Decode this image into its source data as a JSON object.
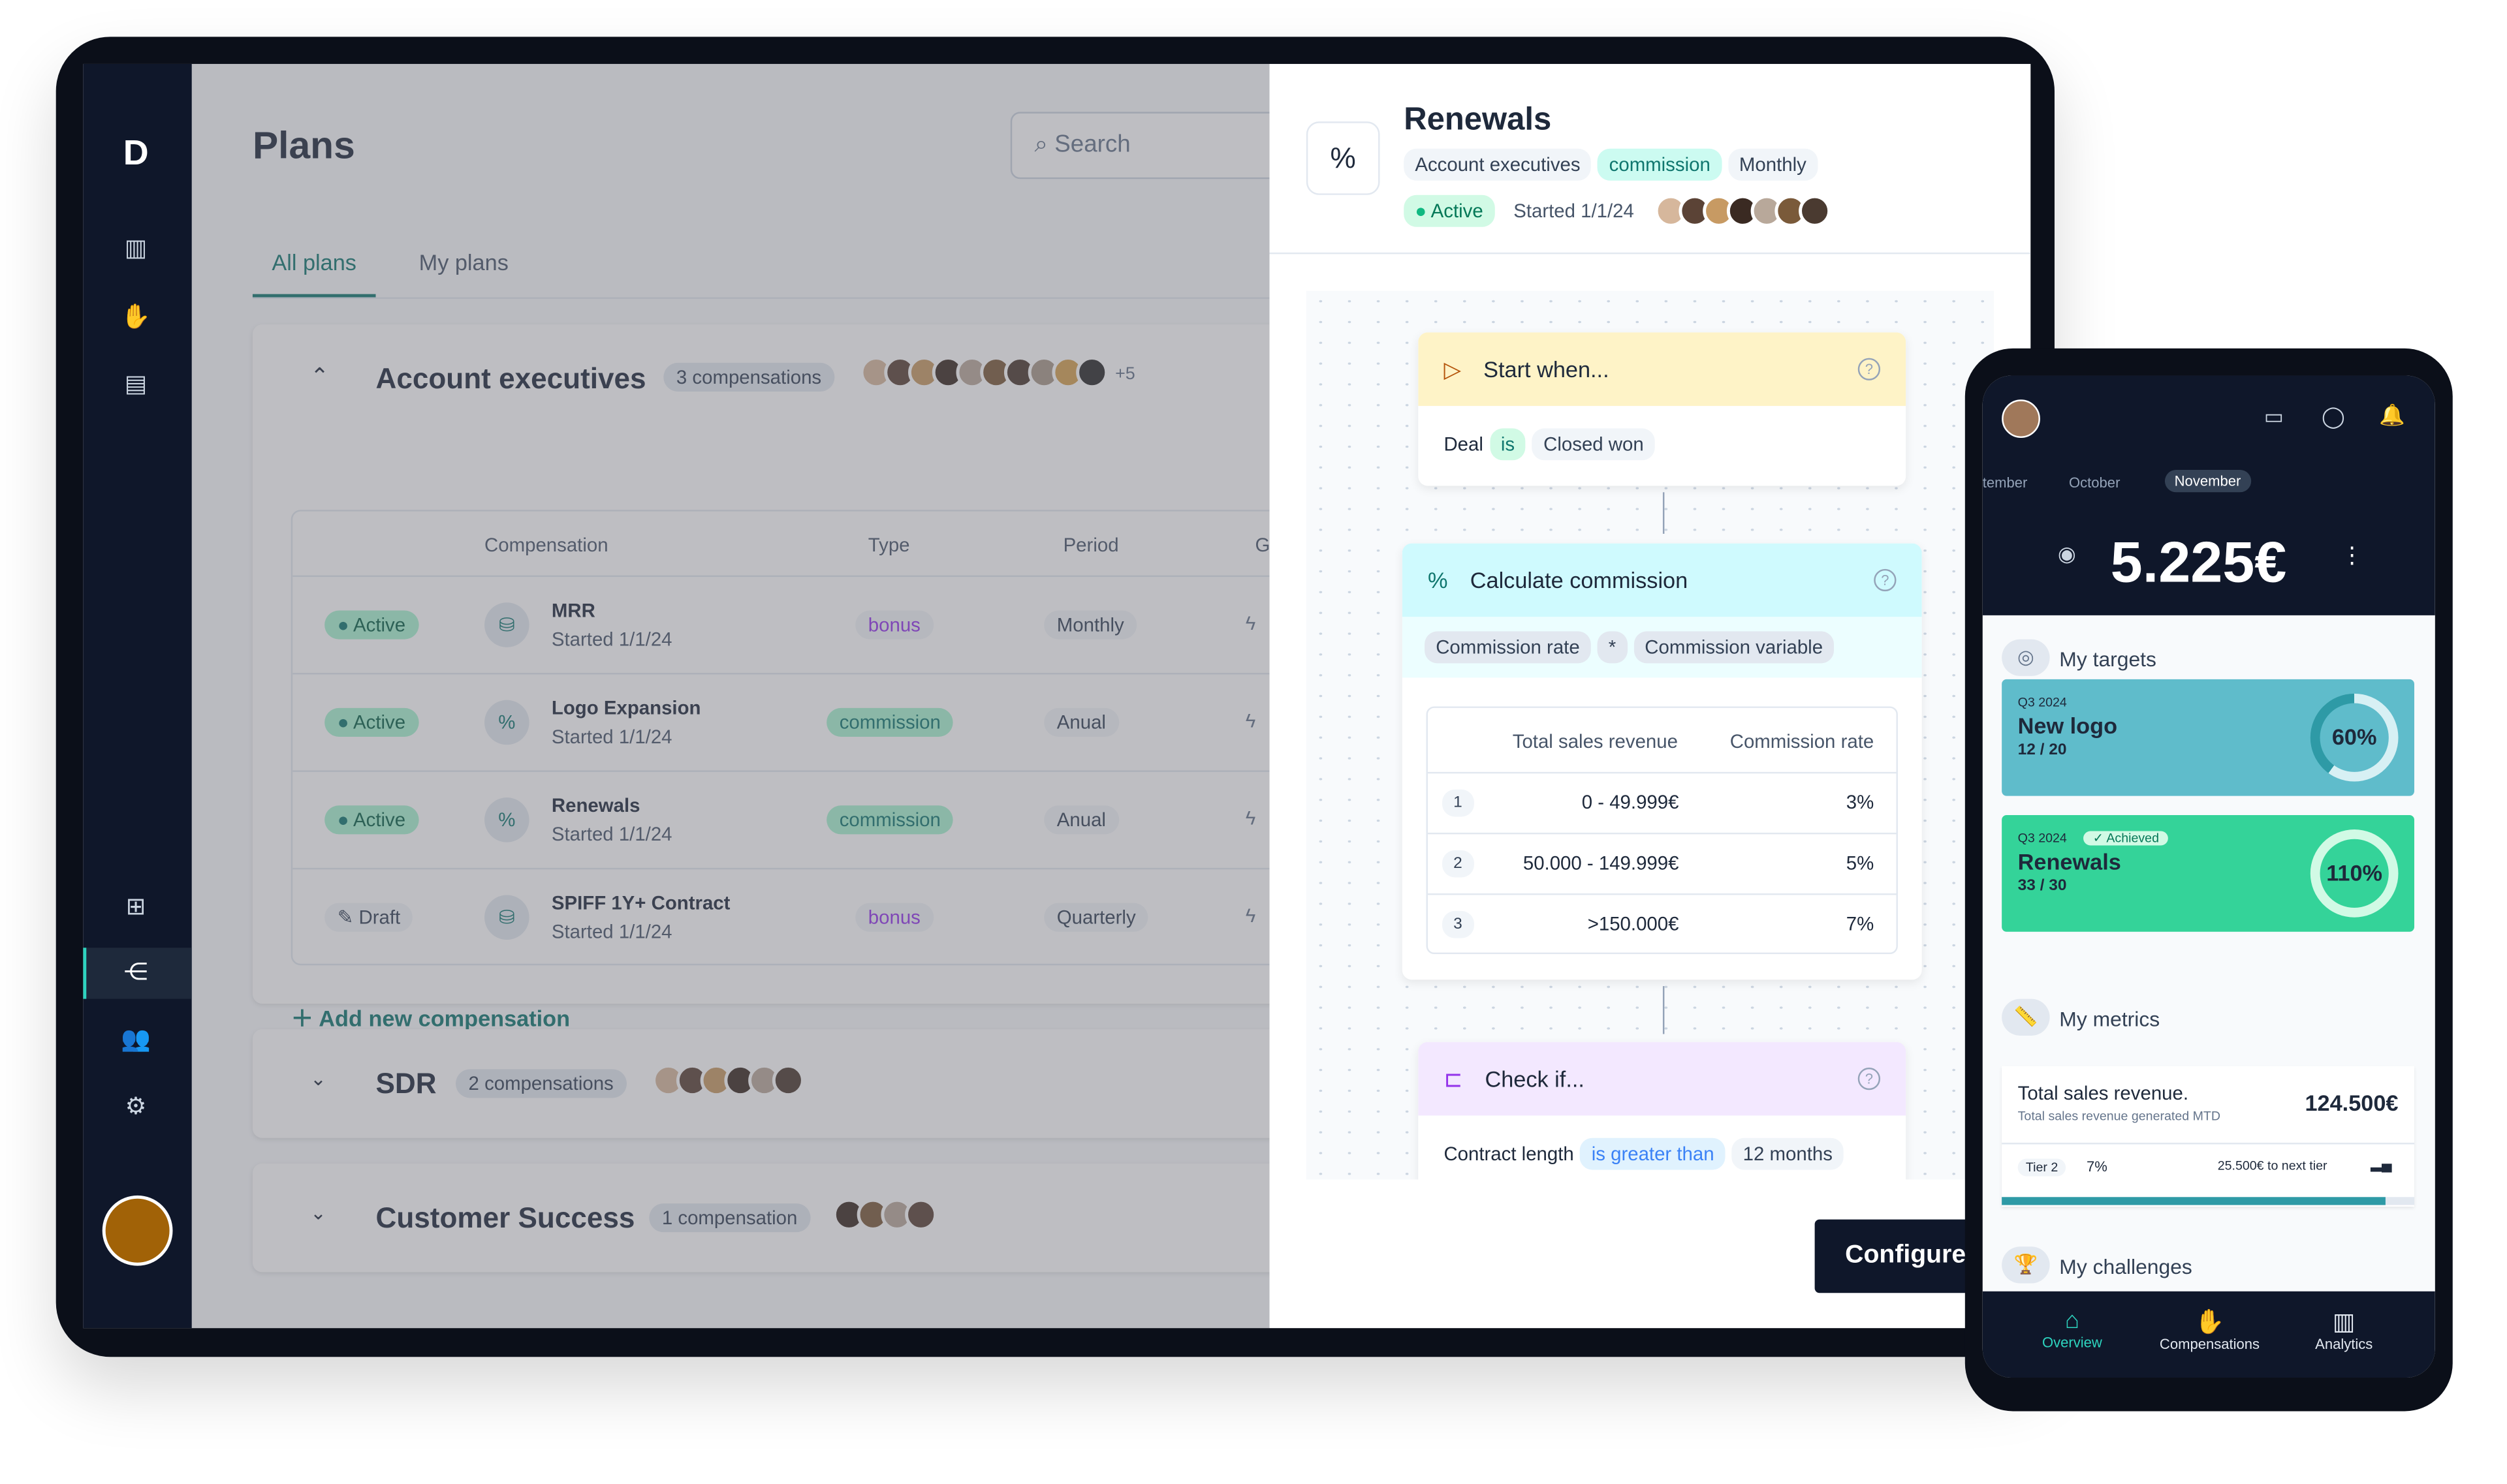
{
  "colors": {
    "accent": "#0f766e",
    "active": "#10b981",
    "commission": "#a7f3d0",
    "bonus": "#9333ea",
    "sidebar": "#0f172a"
  },
  "sidebar": {
    "icons": [
      "logo-icon",
      "dashboard-icon",
      "compensation-icon",
      "document-icon",
      "org-chart-icon",
      "workflow-icon",
      "users-icon",
      "settings-icon"
    ]
  },
  "plans": {
    "title": "Plans",
    "search_placeholder": "Search",
    "tabs": [
      {
        "label": "All plans"
      },
      {
        "label": "My plans"
      }
    ],
    "groups": [
      {
        "name": "Account executives",
        "count": "3 compensations",
        "extra": "+5",
        "columns": [
          "Compensation",
          "Type",
          "Period",
          "G"
        ],
        "rows": [
          {
            "status": "Active",
            "name": "MRR",
            "started": "Started 1/1/24",
            "type": "bonus",
            "period": "Monthly",
            "icon": "gift-icon"
          },
          {
            "status": "Active",
            "name": "Logo Expansion",
            "started": "Started 1/1/24",
            "type": "commission",
            "period": "Anual",
            "icon": "percent-icon"
          },
          {
            "status": "Active",
            "name": "Renewals",
            "started": "Started 1/1/24",
            "type": "commission",
            "period": "Anual",
            "icon": "percent-icon"
          },
          {
            "status": "Draft",
            "name": "SPIFF 1Y+ Contract",
            "started": "Started 1/1/24",
            "type": "bonus",
            "period": "Quarterly",
            "icon": "gift-icon"
          }
        ],
        "add_label": "Add new compensation"
      },
      {
        "name": "SDR",
        "count": "2 compensations"
      },
      {
        "name": "Customer Success",
        "count": "1 compensation"
      }
    ]
  },
  "detail": {
    "title": "Renewals",
    "tags": [
      "Account executives",
      "commission",
      "Monthly"
    ],
    "status": "Active",
    "started": "Started 1/1/24",
    "start": {
      "title": "Start when...",
      "conds": [
        "Deal",
        "is",
        "Closed won"
      ]
    },
    "calc": {
      "title": "Calculate commission",
      "formula": [
        "Commission rate",
        "*",
        "Commission variable"
      ],
      "headers": [
        "Total sales revenue",
        "Commission rate"
      ],
      "tiers": [
        {
          "n": "1",
          "range": "0 - 49.999€",
          "rate": "3%"
        },
        {
          "n": "2",
          "range": "50.000 - 149.999€",
          "rate": "5%"
        },
        {
          "n": "3",
          "range": ">150.000€",
          "rate": "7%"
        }
      ]
    },
    "check": {
      "title": "Check if...",
      "conds": [
        "Contract length",
        "is greater than",
        "12 months"
      ]
    },
    "configure": "Configure"
  },
  "mobile": {
    "months": [
      "tember",
      "October",
      "November"
    ],
    "amount": "5.225€",
    "targets_label": "My targets",
    "targets": [
      {
        "period": "Q3 2024",
        "name": "New logo",
        "progress": "12 / 20",
        "pct": "60%",
        "value": 60
      },
      {
        "period": "Q3 2024",
        "badge": "Achieved",
        "name": "Renewals",
        "progress": "33 / 30",
        "pct": "110%",
        "value": 110
      }
    ],
    "metrics_label": "My metrics",
    "metric": {
      "title": "Total sales revenue.",
      "sub": "Total sales revenue generated MTD",
      "value": "124.500€",
      "tier": "Tier 2",
      "rate": "7%",
      "next": "25.500€ to next tier",
      "progress": 93
    },
    "challenges_label": "My challenges",
    "nav": [
      {
        "label": "Overview"
      },
      {
        "label": "Compensations"
      },
      {
        "label": "Analytics"
      }
    ]
  }
}
